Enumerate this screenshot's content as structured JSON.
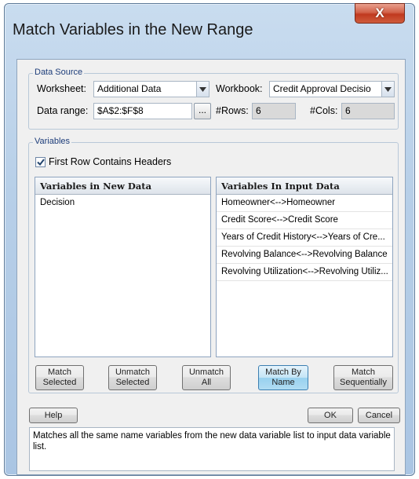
{
  "window": {
    "title": "Match Variables in the New Range",
    "close_label": "X"
  },
  "data_source": {
    "group_label": "Data Source",
    "worksheet_label": "Worksheet:",
    "worksheet_value": "Additional Data",
    "workbook_label": "Workbook:",
    "workbook_value": "Credit Approval Decisio",
    "range_label": "Data range:",
    "range_value": "$A$2:$F$8",
    "range_button": "...",
    "rows_label": "#Rows:",
    "rows_value": "6",
    "cols_label": "#Cols:",
    "cols_value": "6"
  },
  "variables": {
    "group_label": "Variables",
    "first_row_headers_label": "First Row Contains Headers",
    "first_row_headers_checked": true,
    "new_data": {
      "header": "Variables in New Data",
      "items": [
        "Decision"
      ]
    },
    "input_data": {
      "header": "Variables In Input Data",
      "items": [
        "Homeowner<-->Homeowner",
        "Credit Score<-->Credit Score",
        "Years of Credit History<-->Years of Cre...",
        "Revolving Balance<-->Revolving Balance",
        "Revolving Utilization<-->Revolving Utiliz..."
      ]
    },
    "buttons": {
      "match_selected": "Match Selected",
      "unmatch_selected": "Unmatch Selected",
      "unmatch_all": "Unmatch All",
      "match_by_name": "Match By Name",
      "match_sequentially": "Match Sequentially"
    }
  },
  "footer": {
    "help": "Help",
    "ok": "OK",
    "cancel": "Cancel",
    "description": "Matches all the same name variables from the new data variable list to input data variable list."
  }
}
